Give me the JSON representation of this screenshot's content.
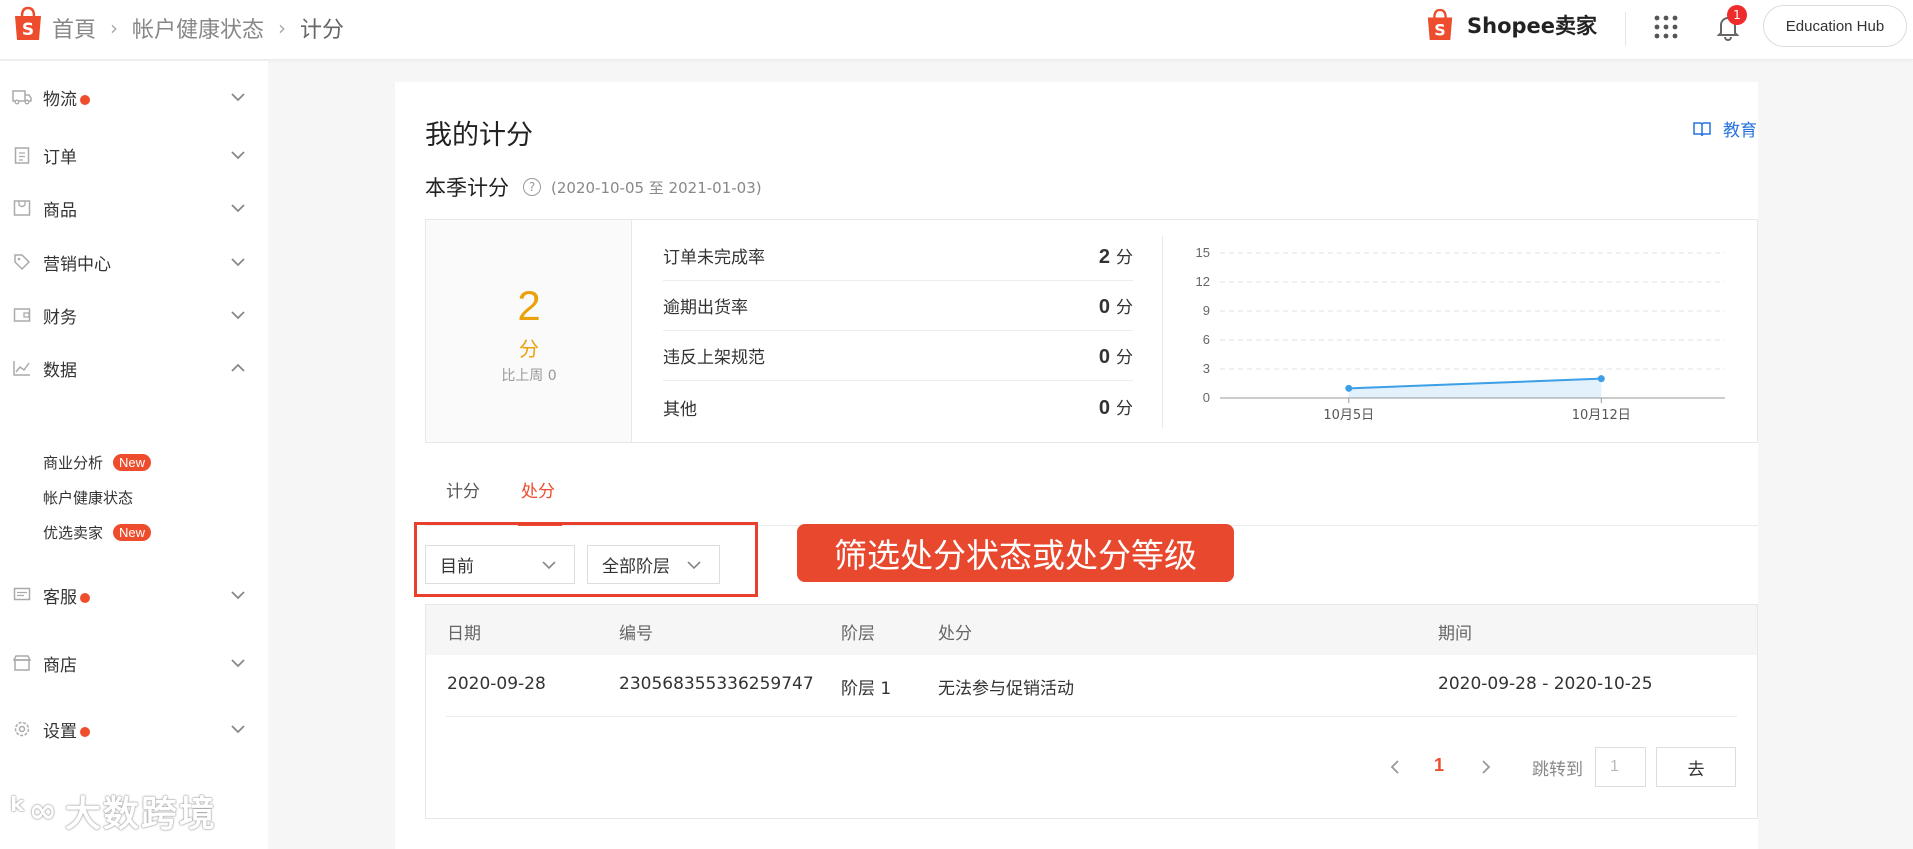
{
  "header": {
    "breadcrumbs": [
      "首頁",
      "帐户健康状态",
      "计分"
    ],
    "brand_name": "Shopee卖家",
    "notification_count": "1",
    "education_hub_label": "Education Hub"
  },
  "sidebar": {
    "items": [
      {
        "label": "物流",
        "icon": "truck-icon"
      },
      {
        "label": "订单",
        "icon": "clipboard-icon"
      },
      {
        "label": "商品",
        "icon": "bag-icon"
      },
      {
        "label": "营销中心",
        "icon": "tag-icon"
      },
      {
        "label": "财务",
        "icon": "wallet-icon"
      },
      {
        "label": "数据",
        "icon": "chart-icon"
      },
      {
        "label": "客服",
        "icon": "chat-icon"
      },
      {
        "label": "商店",
        "icon": "store-icon"
      },
      {
        "label": "设置",
        "icon": "gear-icon"
      }
    ],
    "data_subitems": [
      {
        "label": "商业分析",
        "tag": "New"
      },
      {
        "label": "帐户健康状态"
      },
      {
        "label": "优选卖家",
        "tag": "New"
      }
    ],
    "watermark": "大数跨境"
  },
  "main": {
    "title": "我的计分",
    "education_link": "教育",
    "season_label": "本季计分",
    "season_help": "?",
    "season_range": "(2020-10-05 至 2021-01-03)",
    "score": {
      "value": "2",
      "unit": "分",
      "compare": "比上周 0"
    },
    "metrics": [
      {
        "label": "订单未完成率",
        "value": "2",
        "unit": "分"
      },
      {
        "label": "逾期出货率",
        "value": "0",
        "unit": "分"
      },
      {
        "label": "违反上架规范",
        "value": "0",
        "unit": "分"
      },
      {
        "label": "其他",
        "value": "0",
        "unit": "分"
      }
    ],
    "tabs": [
      "计分",
      "处分"
    ],
    "filters": {
      "status": "目前",
      "tier": "全部阶层"
    },
    "callout": "筛选处分状态或处分等级",
    "table": {
      "headers": [
        "日期",
        "编号",
        "阶层",
        "处分",
        "期间"
      ],
      "rows": [
        [
          "2020-09-28",
          "230568355336259747",
          "阶层 1",
          "无法参与促销活动",
          "2020-09-28 - 2020-10-25"
        ]
      ]
    },
    "pagination": {
      "current": "1",
      "jump_label": "跳转到",
      "jump_placeholder": "1",
      "go_label": "去"
    }
  },
  "chart_data": {
    "type": "line",
    "categories": [
      "10月5日",
      "10月12日"
    ],
    "values": [
      1,
      2
    ],
    "yticks": [
      0,
      3,
      6,
      9,
      12,
      15
    ],
    "ylim": [
      0,
      15
    ],
    "color": "#3d9fe6",
    "grid": true
  }
}
